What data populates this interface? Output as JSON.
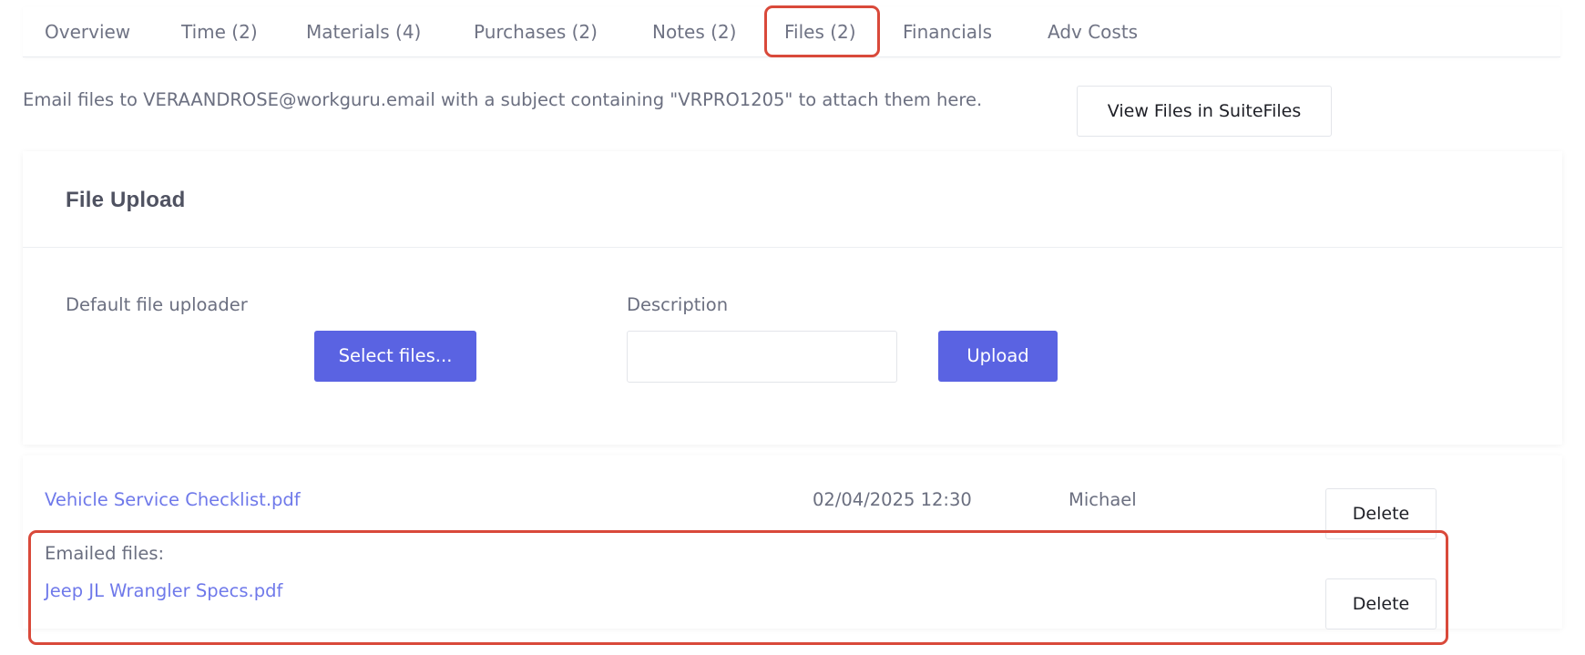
{
  "tabs": [
    {
      "label": "Overview"
    },
    {
      "label": "Time (2)"
    },
    {
      "label": "Materials (4)"
    },
    {
      "label": "Purchases (2)"
    },
    {
      "label": "Notes (2)"
    },
    {
      "label": "Files (2)"
    },
    {
      "label": "Financials"
    },
    {
      "label": "Adv Costs"
    }
  ],
  "email_info": "Email files to VERAANDROSE@workguru.email with a subject containing \"VRPRO1205\" to attach them here.",
  "suitefiles_button": "View Files in SuiteFiles",
  "upload": {
    "title": "File Upload",
    "uploader_label": "Default file uploader",
    "select_button": "Select files...",
    "description_label": "Description",
    "description_value": "",
    "upload_button": "Upload"
  },
  "files": [
    {
      "name": "Vehicle Service Checklist.pdf",
      "date": "02/04/2025 12:30",
      "user": "Michael",
      "delete": "Delete"
    }
  ],
  "emailed": {
    "label": "Emailed files:",
    "items": [
      {
        "name": "Jeep JL Wrangler Specs.pdf",
        "delete": "Delete"
      }
    ]
  },
  "colors": {
    "primary": "#5a63e2",
    "link": "#6f79ea",
    "highlight": "#d9493a"
  }
}
